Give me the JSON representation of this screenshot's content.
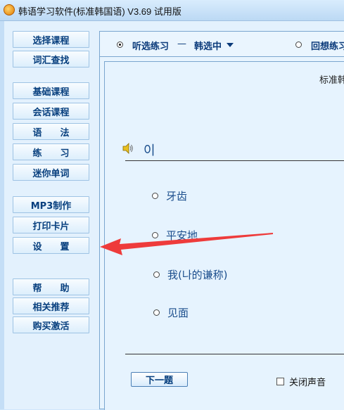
{
  "window": {
    "title": "韩语学习软件(标准韩国语) V3.69 试用版",
    "icon": "app-logo-icon"
  },
  "sidebar": {
    "groups": [
      [
        "选择课程",
        "词汇查找"
      ],
      [
        "基础课程",
        "会话课程",
        "语　　法",
        "练　　习",
        "迷你单词"
      ],
      [
        "MP3制作",
        "打印卡片",
        "设　　置"
      ],
      [
        "帮　　助",
        "相关推荐",
        "购买激活"
      ]
    ]
  },
  "mode_bar": {
    "option1_label": "听选练习",
    "separator": "—",
    "option1_sub": "韩选中",
    "option2_label": "回想练习",
    "selected": "option1"
  },
  "panel": {
    "header": "标准韩",
    "question": "이",
    "options": [
      "牙齿",
      "平安地",
      "我(나的谦称)",
      "见面"
    ],
    "next_button": "下一题",
    "mute_label": "关闭声音",
    "mute_checked": false
  },
  "annotation": {
    "arrow_color": "#ee3b3b"
  }
}
